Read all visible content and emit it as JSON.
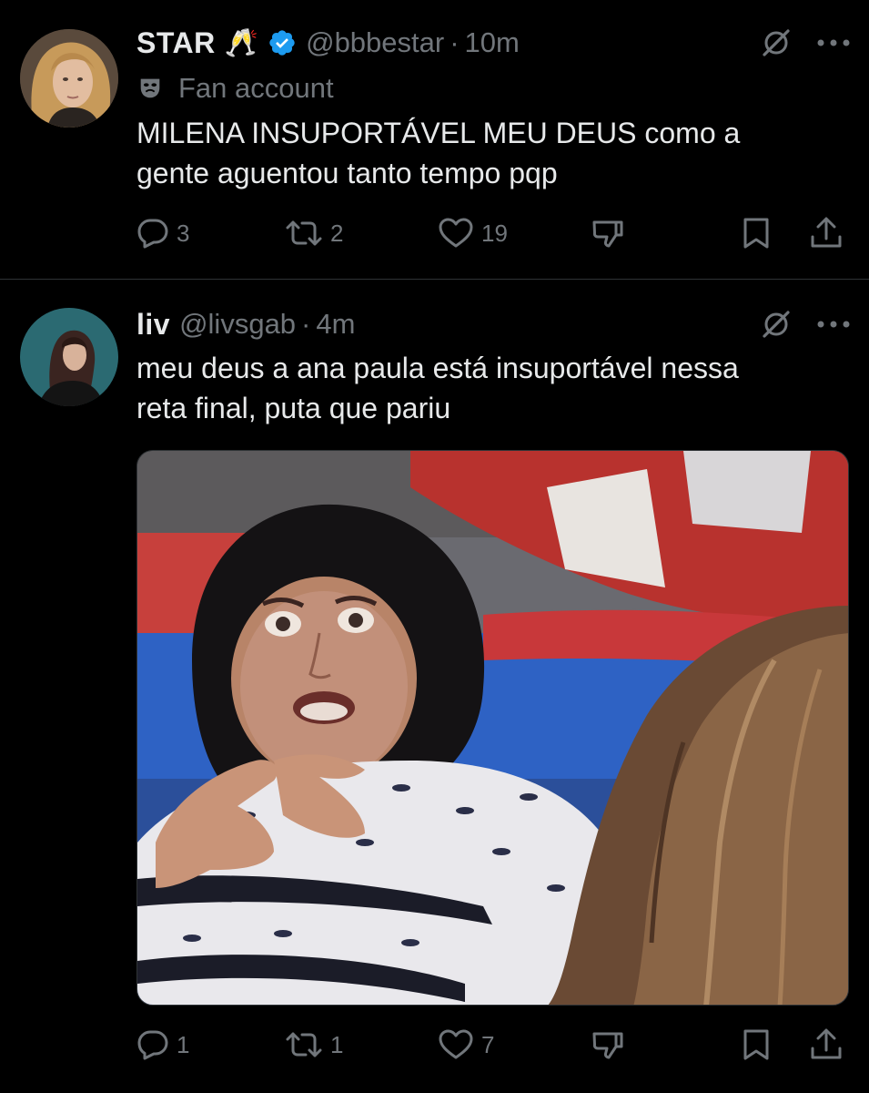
{
  "tweets": [
    {
      "display_name": "STAR",
      "name_emoji": "🥂",
      "verified": true,
      "handle": "@bbbestar",
      "separator": "·",
      "time": "10m",
      "label": "Fan account",
      "text_lines": [
        "MILENA INSUPORTÁVEL MEU DEUS como a",
        "gente aguentou tanto tempo pqp"
      ],
      "counts": {
        "replies": "3",
        "reposts": "2",
        "likes": "19"
      }
    },
    {
      "display_name": "liv",
      "handle": "@livsgab",
      "separator": "·",
      "time": "4m",
      "text_lines": [
        "meu deus a ana paula está insuportável nessa",
        "reta final, puta que pariu"
      ],
      "has_media": true,
      "counts": {
        "replies": "1",
        "reposts": "1",
        "likes": "7"
      }
    }
  ],
  "colors": {
    "background": "#000000",
    "text_primary": "#e7e9ea",
    "text_secondary": "#71767b",
    "divider": "#2f3336",
    "verified_blue": "#1d9bf0"
  },
  "icons": [
    "reply-icon",
    "repost-icon",
    "like-icon",
    "dislike-icon",
    "bookmark-icon",
    "share-icon",
    "grok-icon",
    "more-icon",
    "verified-icon",
    "mask-icon"
  ]
}
